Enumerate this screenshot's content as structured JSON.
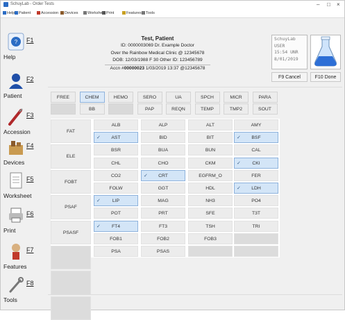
{
  "window": {
    "title": "SchuyLab - Order Tests"
  },
  "menu": [
    {
      "label": "Help",
      "icon": "help-icon"
    },
    {
      "label": "Patient",
      "icon": "patient-icon"
    },
    {
      "label": "Accession",
      "icon": "accession-icon"
    },
    {
      "label": "Devices",
      "icon": "devices-icon"
    },
    {
      "label": "Worksheet",
      "icon": "worksheet-icon"
    },
    {
      "label": "Print",
      "icon": "print-icon"
    },
    {
      "label": "Features",
      "icon": "features-icon"
    },
    {
      "label": "Tools",
      "icon": "tools-icon"
    }
  ],
  "sidebar": [
    {
      "key": "F1",
      "label": "Help",
      "icon": "help-icon"
    },
    {
      "key": "F2",
      "label": "Patient",
      "icon": "patient-icon"
    },
    {
      "key": "F3",
      "label": "Accession",
      "icon": "accession-icon"
    },
    {
      "key": "F4",
      "label": "Devices",
      "icon": "devices-icon"
    },
    {
      "key": "F5",
      "label": "Worksheet",
      "icon": "worksheet-icon"
    },
    {
      "key": "F6",
      "label": "Print",
      "icon": "print-icon"
    },
    {
      "key": "F7",
      "label": "Features",
      "icon": "features-icon"
    },
    {
      "key": "F8",
      "label": "Tools",
      "icon": "tools-icon"
    }
  ],
  "patient": {
    "name": "Test, Patient",
    "id_line": "ID: 0000003069 Dr. Example Doctor",
    "clinic_line": "Over the Rainbow Medical Clinic @ 12345678",
    "dob_line": "DOB: 12/03/1988 F 30   Other ID: 123456789",
    "accn_prefix": "Accn #",
    "accn_number": "00000023",
    "accn_suffix": " 1/03/2019 13:37 @12345678"
  },
  "lcd": {
    "lines": [
      "SchuyLab",
      "USER",
      "15:54 UNR",
      "8/01/2019"
    ]
  },
  "buttons": {
    "cancel": "F9 Cancel",
    "done": "F10 Done"
  },
  "colors": {
    "selected_bg": "#d3e5f7",
    "tab_active_bg": "#dbe9f8",
    "accent": "#2b6cc4"
  },
  "tabs_row1": [
    "FREE",
    "CHEM",
    "HEMO",
    "SERO",
    "UA",
    "SPCH",
    "MICR",
    "PARA"
  ],
  "tabs_row2": [
    "",
    "BB",
    "",
    "PAP",
    "REQN",
    "TEMP",
    "TMP2",
    "SOUT"
  ],
  "active_tab": "CHEM",
  "side_tests": [
    "FAT",
    "ELE",
    "FOBT",
    "PSAF",
    "PSASF",
    "",
    "",
    ""
  ],
  "tests": [
    [
      {
        "t": "ALB"
      },
      {
        "t": "ALP"
      },
      {
        "t": "ALT"
      },
      {
        "t": "AMY"
      }
    ],
    [
      {
        "t": "AST",
        "s": true
      },
      {
        "t": "BID"
      },
      {
        "t": "BIT"
      },
      {
        "t": "BSF",
        "s": true
      }
    ],
    [
      {
        "t": "BSR"
      },
      {
        "t": "BUA"
      },
      {
        "t": "BUN"
      },
      {
        "t": "CAL"
      }
    ],
    [
      {
        "t": "CHL"
      },
      {
        "t": "CHO"
      },
      {
        "t": "CKM"
      },
      {
        "t": "CKI",
        "s": true
      }
    ],
    [
      {
        "t": "CO2"
      },
      {
        "t": "CRT",
        "s": true
      },
      {
        "t": "EGFRM_O"
      },
      {
        "t": "FER"
      }
    ],
    [
      {
        "t": "FOLW"
      },
      {
        "t": "GGT"
      },
      {
        "t": "HDL"
      },
      {
        "t": "LDH",
        "s": true
      }
    ],
    [
      {
        "t": "LIP",
        "s": true
      },
      {
        "t": "MAG"
      },
      {
        "t": "NH3"
      },
      {
        "t": "PO4"
      }
    ],
    [
      {
        "t": "POT"
      },
      {
        "t": "PRT"
      },
      {
        "t": "SFE"
      },
      {
        "t": "T3T"
      }
    ],
    [
      {
        "t": "FT4",
        "s": true
      },
      {
        "t": "FT3"
      },
      {
        "t": "TSH"
      },
      {
        "t": "TRI"
      }
    ],
    [
      {
        "t": "FOB1"
      },
      {
        "t": "FOB2"
      },
      {
        "t": "FOB3"
      },
      {
        "t": ""
      }
    ],
    [
      {
        "t": "PSA"
      },
      {
        "t": "PSAS"
      },
      {
        "t": ""
      },
      {
        "t": ""
      }
    ]
  ],
  "check_glyph": "✓"
}
